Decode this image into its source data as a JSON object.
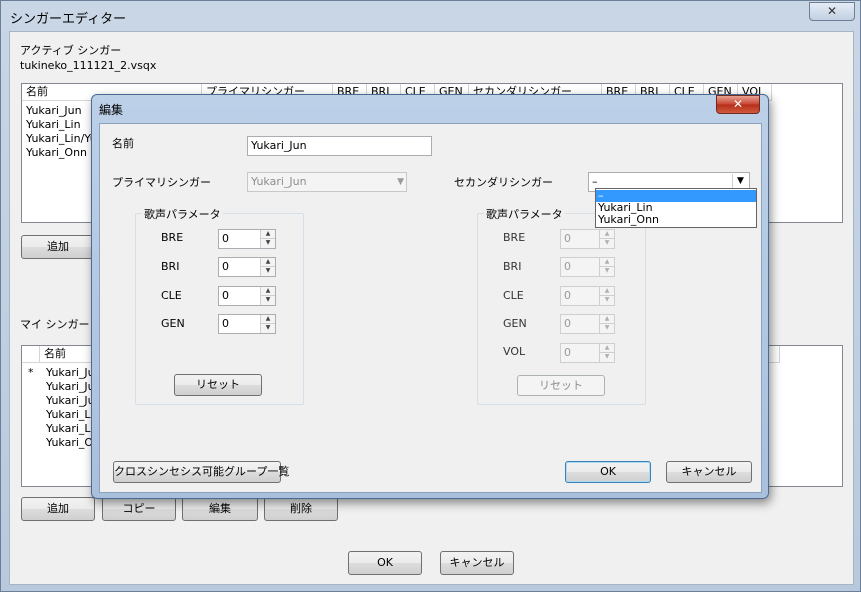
{
  "main_window": {
    "title": "シンガーエディター",
    "close_glyph": "✕",
    "active_singer_label": "アクティブ シンガー",
    "filename": "tukineko_111121_2.vsqx",
    "active_table": {
      "headers": [
        "名前",
        "プライマリシンガー",
        "BRE",
        "BRI",
        "CLE",
        "GEN",
        "セカンダリシンガー",
        "BRE",
        "BRI",
        "CLE",
        "GEN",
        "VOL"
      ],
      "rows": [
        "Yukari_Jun",
        "Yukari_Lin",
        "Yukari_Lin/Yuk",
        "Yukari_Onn"
      ]
    },
    "add_button_top": "追加",
    "my_singer_label": "マイ シンガー",
    "my_table": {
      "headers": [
        "名前"
      ],
      "marker": "*",
      "rows": [
        "Yukari_Ju",
        "Yukari_Ju",
        "Yukari_Ju",
        "Yukari_Lin",
        "Yukari_Lin",
        "Yukari_On"
      ]
    },
    "bottom_buttons": {
      "add": "追加",
      "copy": "コピー",
      "edit": "編集",
      "delete": "削除"
    },
    "ok": "OK",
    "cancel": "キャンセル"
  },
  "edit_dialog": {
    "title": "編集",
    "close_glyph": "✕",
    "name_label": "名前",
    "name_value": "Yukari_Jun",
    "primary_label": "プライマリシンガー",
    "primary_value": "Yukari_Jun",
    "secondary_label": "セカンダリシンガー",
    "secondary_value": "–",
    "dropdown_arrow": "▼",
    "dropdown_options": [
      "–",
      "Yukari_Lin",
      "Yukari_Onn"
    ],
    "dropdown_selected_index": 0,
    "primary_params": {
      "group_title": "歌声パラメータ",
      "params": [
        {
          "label": "BRE",
          "value": "0"
        },
        {
          "label": "BRI",
          "value": "0"
        },
        {
          "label": "CLE",
          "value": "0"
        },
        {
          "label": "GEN",
          "value": "0"
        }
      ],
      "reset": "リセット"
    },
    "secondary_params": {
      "group_title": "歌声パラメータ",
      "params": [
        {
          "label": "BRE",
          "value": "0"
        },
        {
          "label": "BRI",
          "value": "0"
        },
        {
          "label": "CLE",
          "value": "0"
        },
        {
          "label": "GEN",
          "value": "0"
        },
        {
          "label": "VOL",
          "value": "0"
        }
      ],
      "reset": "リセット"
    },
    "cross_synthesis_button": "クロスシンセシス可能グループ一覧",
    "ok": "OK",
    "cancel": "キャンセル"
  },
  "colors": {
    "frame_blue": "#bcd0e8",
    "selection_blue": "#3399ff",
    "close_red": "#c7432f"
  }
}
